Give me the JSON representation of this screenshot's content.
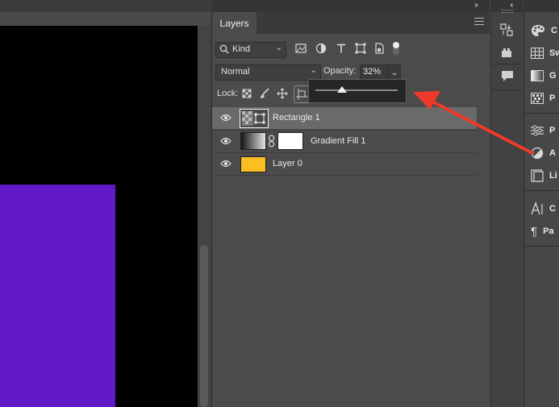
{
  "layers_panel": {
    "tab_label": "Layers",
    "filter": {
      "kind_label": "Kind"
    },
    "blend_mode": "Normal",
    "opacity_label": "Opacity:",
    "opacity_value": "32%",
    "opacity_slider_fraction": 0.32,
    "lock_label": "Lock:",
    "layers": [
      {
        "name": "Rectangle 1",
        "selected": true,
        "thumb": "rectangle-shape"
      },
      {
        "name": "Gradient Fill 1",
        "selected": false,
        "thumb": "gradient",
        "mask": "white"
      },
      {
        "name": "Layer 0",
        "selected": false,
        "thumb": "orange-fill"
      }
    ]
  },
  "right_dock": {
    "items": [
      {
        "icon": "color-palette-icon",
        "label": "C"
      },
      {
        "icon": "swatches-grid-icon",
        "label": "Sw"
      },
      {
        "icon": "gradients-icon",
        "label": "G"
      },
      {
        "icon": "patterns-icon",
        "label": "P"
      },
      {
        "icon": "properties-sliders-icon",
        "label": "P"
      },
      {
        "icon": "adjustments-icon",
        "label": "A"
      },
      {
        "icon": "libraries-icon",
        "label": "Li"
      },
      {
        "icon": "character-icon",
        "label": "C"
      },
      {
        "icon": "paragraph-icon",
        "label": "Pa"
      }
    ]
  },
  "colors": {
    "canvas_background": "#000000",
    "purple_shape": "#6119c7",
    "layer0_swatch": "#fbbf24",
    "annotation_arrow": "#ee3a2b",
    "panel_bg": "#4b4b4b",
    "selected_row": "#6a6a6a"
  }
}
